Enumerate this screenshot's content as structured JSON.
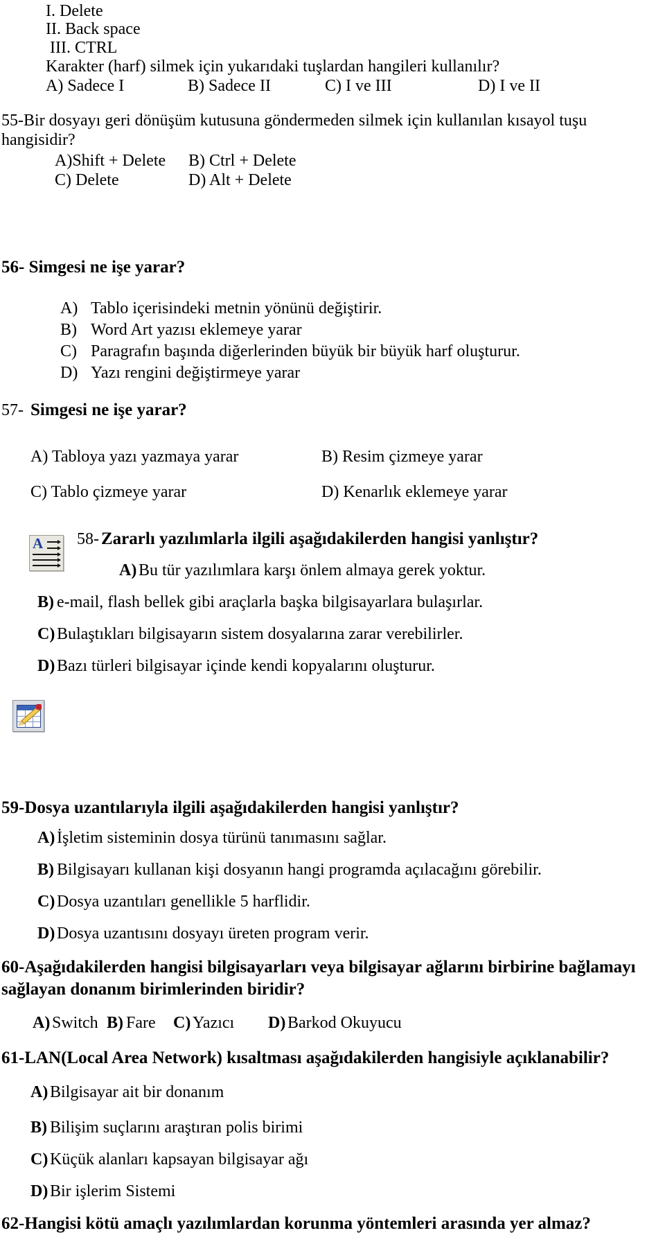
{
  "document": {
    "kind": "exam-question-sheet",
    "language": "tr"
  },
  "q54_tail": {
    "stem_items": [
      "I. Delete",
      "II. Back space",
      "III. CTRL"
    ],
    "question": "Karakter (harf) silmek için yukarıdaki tuşlardan hangileri kullanılır?",
    "options": [
      "A) Sadece I",
      "B) Sadece II",
      "C) I ve III",
      "D) I ve II"
    ]
  },
  "q55": {
    "line1": "55-Bir dosyayı geri dönüşüm kutusuna göndermeden silmek için kullanılan kısayol tuşu",
    "line2": "hangisidir?",
    "options": [
      "A)Shift + Delete",
      "B) Ctrl + Delete",
      "C) Delete",
      "D) Alt + Delete"
    ]
  },
  "q56": {
    "heading": "56- Simgesi ne işe yarar?",
    "options": [
      {
        "letter": "A)",
        "text": "Tablo içerisindeki metnin yönünü değiştirir."
      },
      {
        "letter": "B)",
        "text": "Word Art yazısı eklemeye yarar"
      },
      {
        "letter": "C)",
        "text": "Paragrafın başında diğerlerinden büyük bir büyük harf oluşturur."
      },
      {
        "letter": "D)",
        "text": "Yazı rengini değiştirmeye yarar"
      }
    ]
  },
  "q57": {
    "number": "57-",
    "heading": "Simgesi ne işe yarar?",
    "options": [
      "A) Tabloya yazı yazmaya yarar",
      "B) Resim çizmeye yarar",
      "C) Tablo çizmeye yarar",
      "D) Kenarlık eklemeye yarar"
    ]
  },
  "q58": {
    "number": "58-",
    "heading": "Zararlı yazılımlarla ilgili aşağıdakilerden hangisi yanlıştır?",
    "options": [
      {
        "letter": "A)",
        "text": "Bu tür yazılımlara karşı önlem almaya gerek yoktur."
      },
      {
        "letter": "B)",
        "text": "e-mail, flash bellek gibi araçlarla başka bilgisayarlara bulaşırlar."
      },
      {
        "letter": "C)",
        "text": "Bulaştıkları bilgisayarın sistem dosyalarına zarar verebilirler."
      },
      {
        "letter": "D)",
        "text": "Bazı türleri bilgisayar içinde kendi kopyalarını oluşturur."
      }
    ]
  },
  "q59": {
    "heading": "59-Dosya uzantılarıyla ilgili aşağıdakilerden hangisi yanlıştır?",
    "options": [
      {
        "letter": "A)",
        "text": "İşletim sisteminin dosya türünü tanımasını sağlar."
      },
      {
        "letter": "B)",
        "text": "Bilgisayarı kullanan kişi dosyanın hangi programda açılacağını görebilir."
      },
      {
        "letter": "C)",
        "text": " Dosya uzantıları genellikle 5 harflidir."
      },
      {
        "letter": "D)",
        "text": "Dosya uzantısını dosyayı üreten program verir."
      }
    ]
  },
  "q60": {
    "heading_line1": "60-Aşağıdakilerden hangisi bilgisayarları veya bilgisayar ağlarını birbirine bağlamayı",
    "heading_line2": "sağlayan donanım birimlerinden biridir?",
    "options_inline": [
      {
        "letter": "A)",
        "text": "Switch"
      },
      {
        "letter": "B)",
        "text": "Fare"
      },
      {
        "letter": "C)",
        "text": "Yazıcı"
      },
      {
        "letter": "D)",
        "text": " Barkod Okuyucu"
      }
    ]
  },
  "q61": {
    "heading": "61-LAN(Local Area Network) kısaltması aşağıdakilerden hangisiyle açıklanabilir?",
    "options": [
      {
        "letter": "A)",
        "text": "Bilgisayar ait bir donanım"
      },
      {
        "letter": "B)",
        "text": "Bilişim suçlarını araştıran polis birimi"
      },
      {
        "letter": "C)",
        "text": "Küçük alanları kapsayan bilgisayar ağı"
      },
      {
        "letter": "D)",
        "text": "Bir işlerim Sistemi"
      }
    ]
  },
  "q62": {
    "heading": "62-Hangisi kötü amaçlı yazılımlardan korunma yöntemleri arasında yer almaz?"
  },
  "icons": {
    "dropcap": {
      "name": "drop-cap-icon",
      "letter": "A"
    },
    "drawtable": {
      "name": "draw-table-icon"
    }
  }
}
